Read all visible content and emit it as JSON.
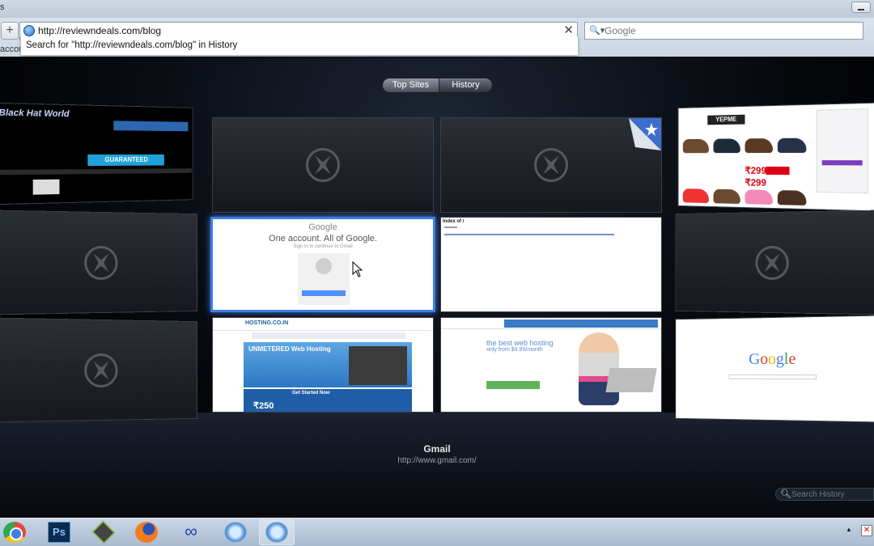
{
  "window": {
    "title_fragment": "s"
  },
  "toolbar": {
    "new_tab_label": "+",
    "address_value": "http://reviewndeals.com/blog",
    "clear_label": "✕",
    "search_placeholder": "Google",
    "search_icon_label": "🔍▾",
    "history_suggestion": "Search for \"http://reviewndeals.com/blog\" in History",
    "bookmarks_fragment": "accour"
  },
  "top_sites": {
    "segmented": {
      "top_sites": "Top Sites",
      "history": "History",
      "active": "Top Sites"
    },
    "hover_title": "Gmail",
    "hover_url": "http://www.gmail.com/",
    "search_history_placeholder": "Search History"
  },
  "thumbnails": {
    "blackhat": {
      "logo": "Black Hat World",
      "badge": "GUARANTEED"
    },
    "yepme": {
      "logo": "YEPME",
      "price1": "₹299",
      "price2": "₹299"
    },
    "google_signin": {
      "logo": "Google",
      "title": "One account. All of Google.",
      "subtitle": "Sign in to continue to Gmail"
    },
    "index": {
      "title": "Index of /"
    },
    "hosting": {
      "logo": "HOSTING.CO.IN",
      "hero_title": "UNMETERED Web Hosting",
      "price": "₹250",
      "started": "Get Started Now"
    },
    "best_hosting": {
      "headline": "the best web hosting",
      "sub": "only from $4.95/month"
    },
    "google_home": {
      "logo": "Google"
    }
  },
  "taskbar": {
    "ps_label": "Ps",
    "app5_label": "∞",
    "tray_up": "▲",
    "tray_flag": "✕"
  },
  "colors": {
    "accent": "#3d7ee6",
    "chrome_bg": "#cdd7e3",
    "stage_bg": "#000000"
  }
}
